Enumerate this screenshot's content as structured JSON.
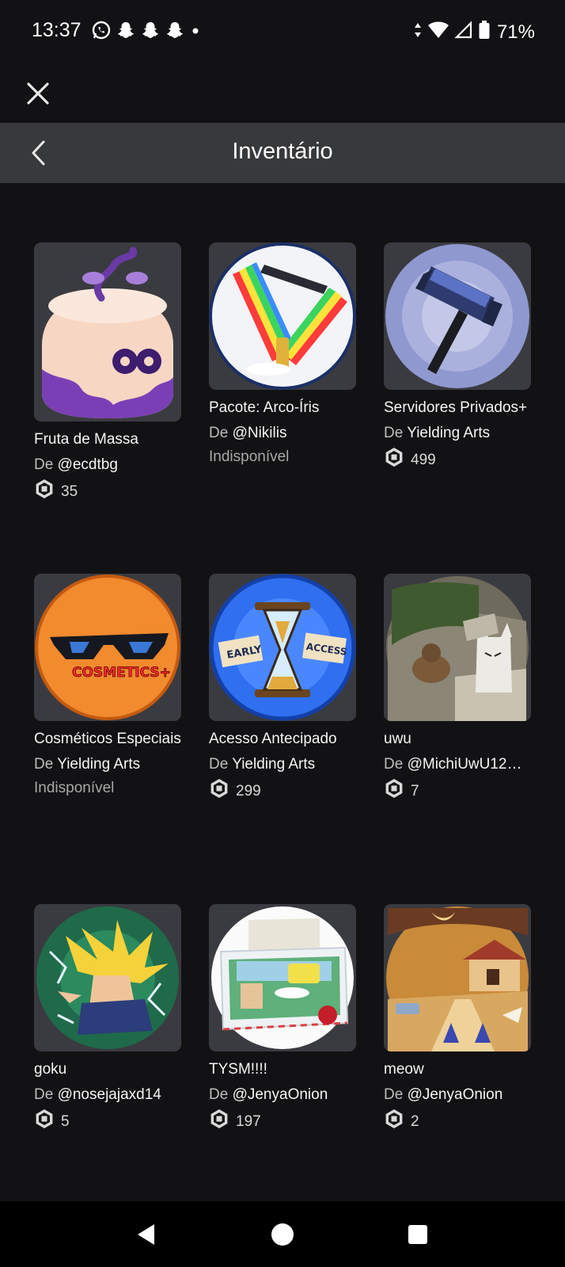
{
  "status_bar": {
    "time": "13:37",
    "battery": "71%",
    "notification_icons": [
      "whatsapp-icon",
      "snapchat-icon",
      "snapchat-icon",
      "snapchat-icon",
      "dot-icon"
    ],
    "system_icons": [
      "data-arrows-icon",
      "wifi-icon",
      "signal-icon",
      "battery-icon"
    ]
  },
  "header": {
    "title": "Inventário",
    "close_icon": "close-icon",
    "back_icon": "chevron-left-icon"
  },
  "by_prefix": "De",
  "items": [
    {
      "name": "Fruta de Massa",
      "creator": "@ecdtbg",
      "price": "35",
      "status": ""
    },
    {
      "name": "Pacote: Arco-Íris",
      "creator": "@Nikilis",
      "price": "",
      "status": "Indisponível"
    },
    {
      "name": "Servidores Privados+",
      "creator": "Yielding Arts",
      "price": "499",
      "status": ""
    },
    {
      "name": "Cosméticos Especiais",
      "creator": "Yielding Arts",
      "price": "",
      "status": "Indisponível"
    },
    {
      "name": "Acesso Antecipado",
      "creator": "Yielding Arts",
      "price": "299",
      "status": ""
    },
    {
      "name": "uwu",
      "creator": "@MichiUwU12…",
      "price": "7",
      "status": ""
    },
    {
      "name": "goku",
      "creator": "@nosejajaxd14",
      "price": "5",
      "status": ""
    },
    {
      "name": "TYSM!!!!",
      "creator": "@JenyaOnion",
      "price": "197",
      "status": ""
    },
    {
      "name": "meow",
      "creator": "@JenyaOnion",
      "price": "2",
      "status": ""
    }
  ],
  "thumbnail_text": {
    "cosmetics": "COSMETICS+",
    "early": "EARLY",
    "access": "ACCESS"
  },
  "colors": {
    "background": "#121214",
    "header_bar": "#38393b",
    "card_bg": "#3a3b40",
    "text_primary": "#f5f5f5",
    "text_secondary": "#bdbdbd"
  },
  "nav": [
    "back-triangle-icon",
    "home-circle-icon",
    "recents-square-icon"
  ]
}
